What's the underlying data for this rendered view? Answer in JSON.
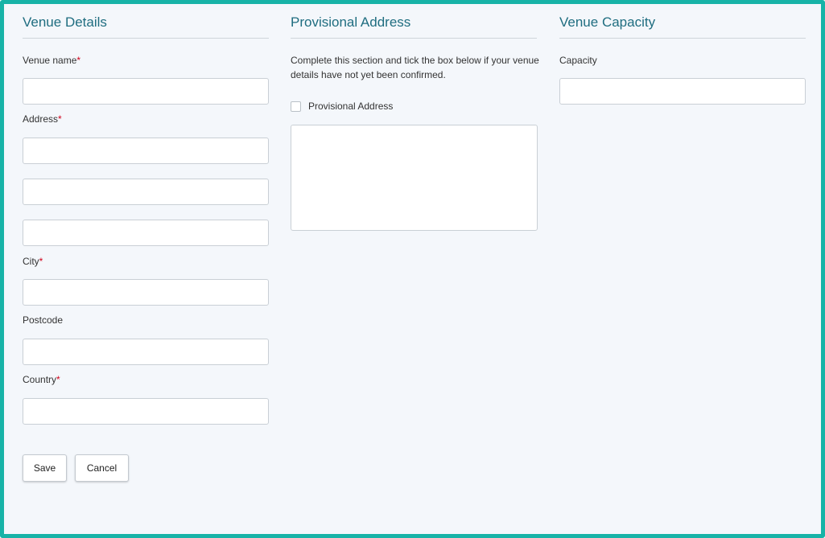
{
  "venue_details": {
    "title": "Venue Details",
    "required_marker": "*",
    "venue_name_label": "Venue name",
    "address_label": "Address",
    "city_label": "City",
    "postcode_label": "Postcode",
    "country_label": "Country",
    "venue_name_value": "",
    "address_line_1_value": "",
    "address_line_2_value": "",
    "address_line_3_value": "",
    "city_value": "",
    "postcode_value": "",
    "country_value": ""
  },
  "provisional_address": {
    "title": "Provisional Address",
    "hint": "Complete this section and tick the box below if your venue details have not yet been confirmed.",
    "checkbox_label": "Provisional Address",
    "checked": false,
    "text_value": ""
  },
  "venue_capacity": {
    "title": "Venue Capacity",
    "capacity_label": "Capacity",
    "capacity_value": ""
  },
  "actions": {
    "save_label": "Save",
    "cancel_label": "Cancel"
  },
  "colors": {
    "frame_border": "#17b3a7",
    "background": "#f4f7fb",
    "section_title": "#1f6d80",
    "required": "#d0021b"
  }
}
